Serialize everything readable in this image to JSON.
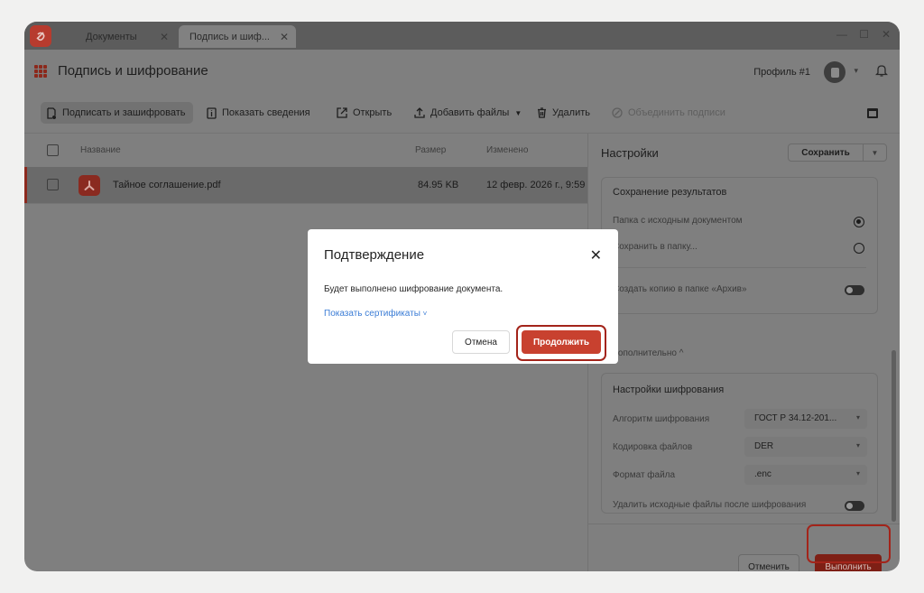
{
  "tabs": [
    {
      "label": "Документы"
    },
    {
      "label": "Подпись и шиф..."
    }
  ],
  "header": {
    "title": "Подпись и шифрование",
    "profile": "Профиль #1"
  },
  "toolbar": {
    "sign_encrypt": "Подписать и зашифровать",
    "show_info": "Показать сведения",
    "open": "Открыть",
    "add_files": "Добавить файлы",
    "delete": "Удалить",
    "merge_signatures": "Объединить подписи"
  },
  "list": {
    "columns": {
      "name": "Название",
      "size": "Размер",
      "modified": "Изменено"
    },
    "rows": [
      {
        "name": "Тайное соглашение.pdf",
        "size": "84.95 KB",
        "modified": "12 февр. 2026 г., 9:59"
      }
    ]
  },
  "settings": {
    "title": "Настройки",
    "save_label": "Сохранить",
    "results": {
      "title": "Сохранение результатов",
      "source_folder": "Папка с исходным документом",
      "save_to_folder": "Сохранить в папку...",
      "archive_copy": "Создать копию в папке «Архив»"
    },
    "additional_label": "Дополнительно",
    "encryption": {
      "title": "Настройки шифрования",
      "algorithm_label": "Алгоритм шифрования",
      "algorithm_value": "ГОСТ Р 34.12-201...",
      "encoding_label": "Кодировка файлов",
      "encoding_value": "DER",
      "format_label": "Формат файла",
      "format_value": ".enc",
      "delete_source_label": "Удалить исходные файлы после шифрования"
    },
    "cancel_label": "Отменить",
    "run_label": "Выполнить"
  },
  "dialog": {
    "title": "Подтверждение",
    "message": "Будет выполнено шифрование документа.",
    "show_certificates": "Показать сертификаты",
    "cancel": "Отмена",
    "continue": "Продолжить"
  },
  "colors": {
    "accent": "#c8412f",
    "highlight": "#a3241a",
    "link": "#3c7dd6",
    "overlay": "#7f7f7f"
  }
}
